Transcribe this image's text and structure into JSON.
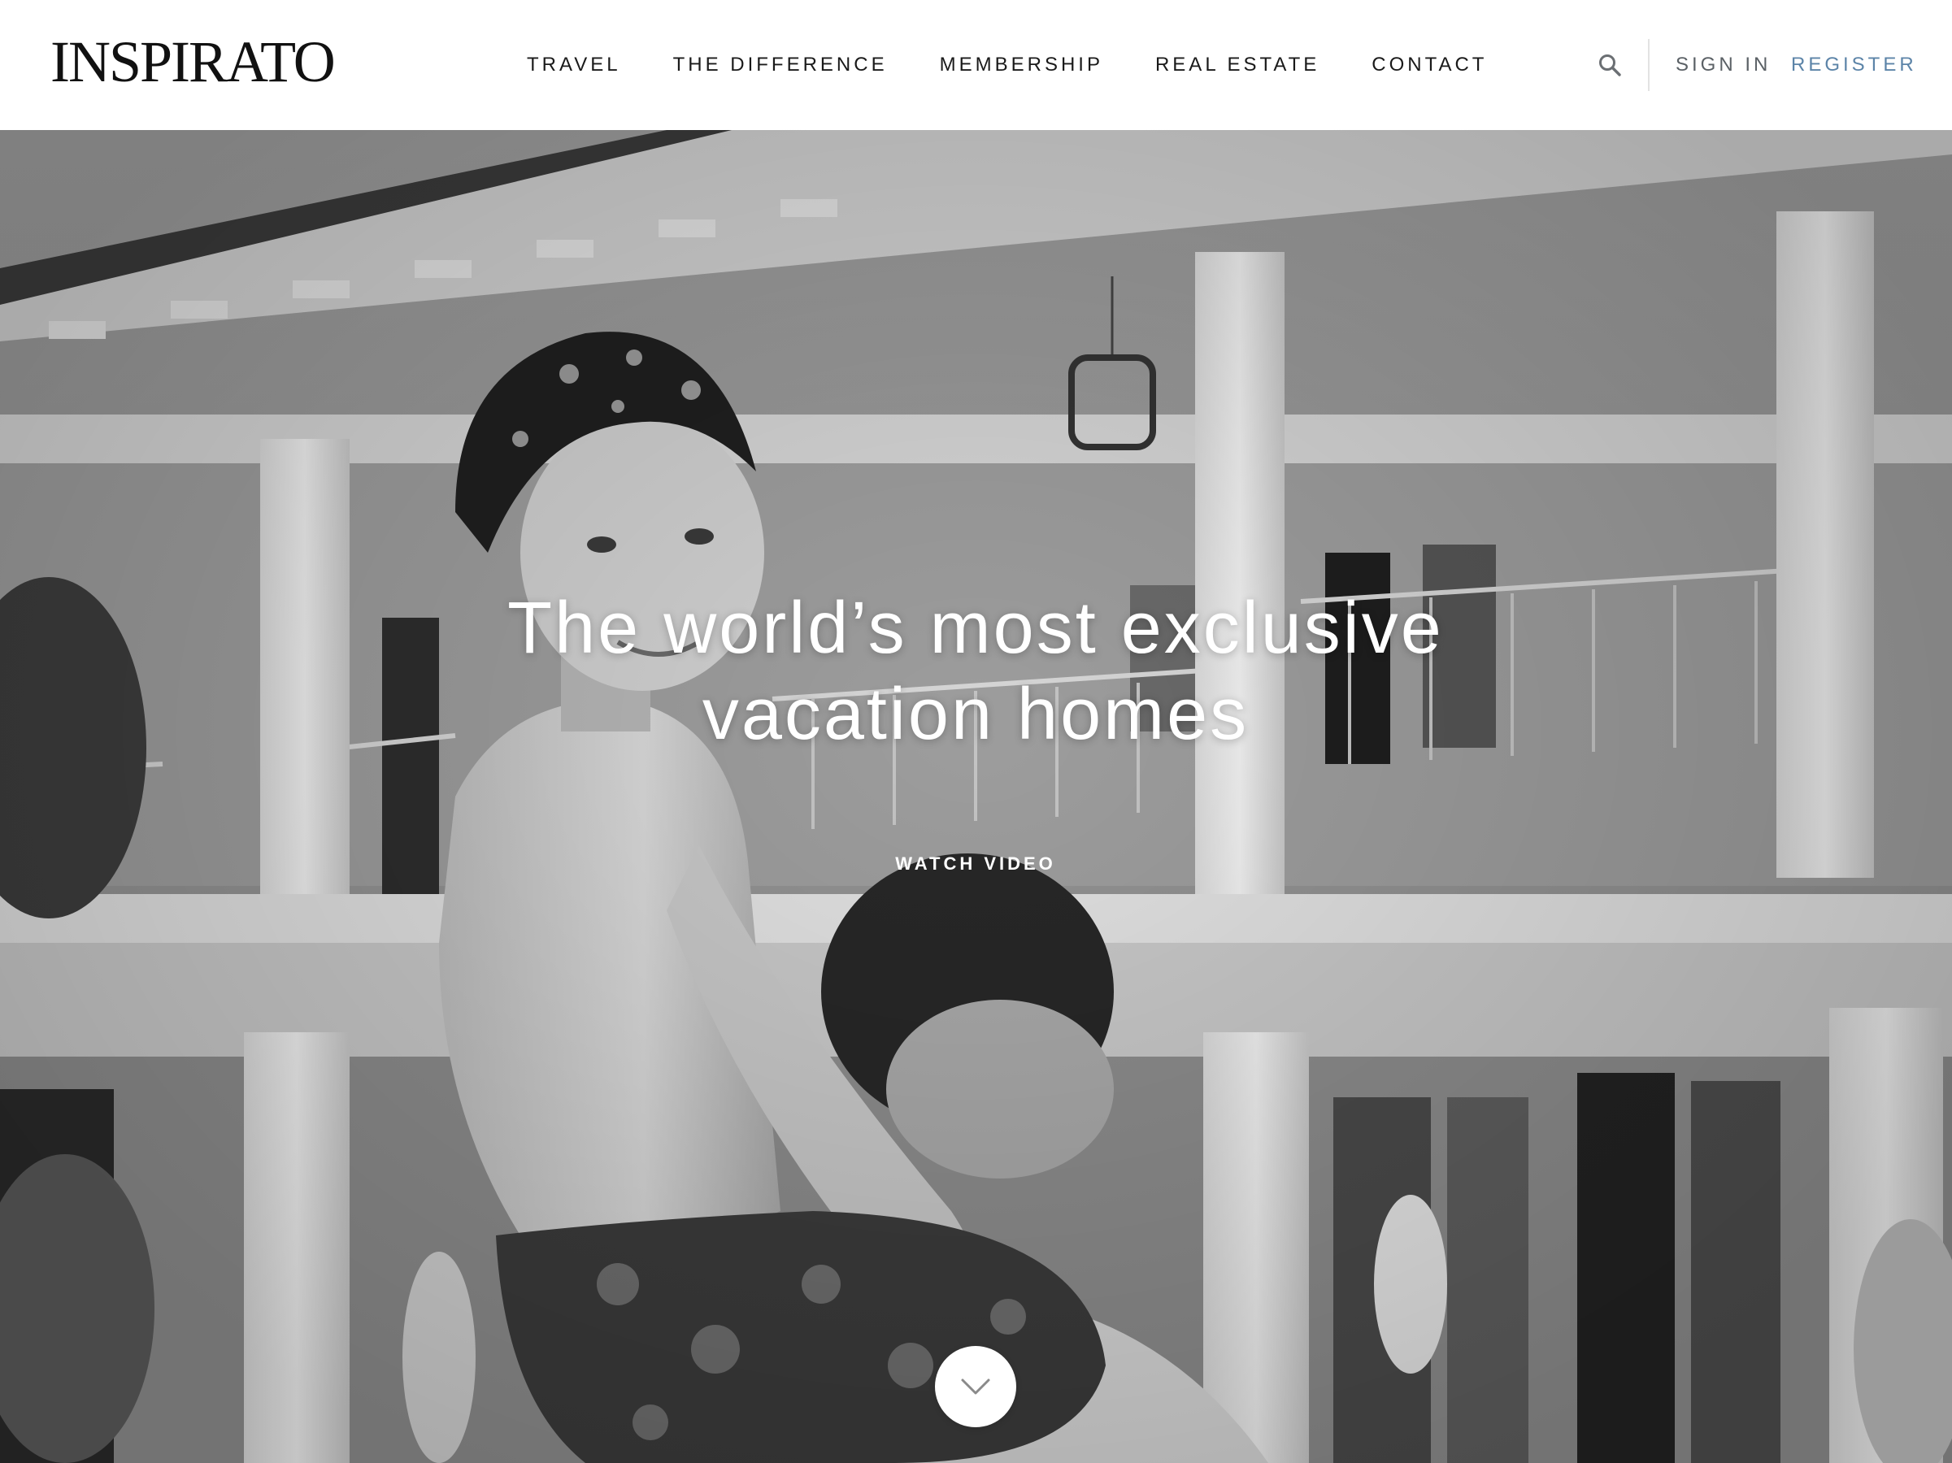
{
  "brand": {
    "logo_text": "INSPIRATO"
  },
  "nav": {
    "items": [
      {
        "label": "TRAVEL"
      },
      {
        "label": "THE DIFFERENCE"
      },
      {
        "label": "MEMBERSHIP"
      },
      {
        "label": "REAL ESTATE"
      },
      {
        "label": "CONTACT"
      }
    ]
  },
  "account": {
    "search_icon": "search-icon",
    "sign_in_label": "SIGN IN",
    "register_label": "REGISTER"
  },
  "hero": {
    "headline_line1": "The world’s most exclusive",
    "headline_line2": "vacation homes",
    "watch_video_label": "WATCH VIDEO",
    "scroll_icon": "chevron-down-icon"
  },
  "colors": {
    "text_dark": "#1a1a1a",
    "sign_in": "#5b6166",
    "register_accent": "#5c84a8",
    "hero_text": "#ffffff"
  }
}
